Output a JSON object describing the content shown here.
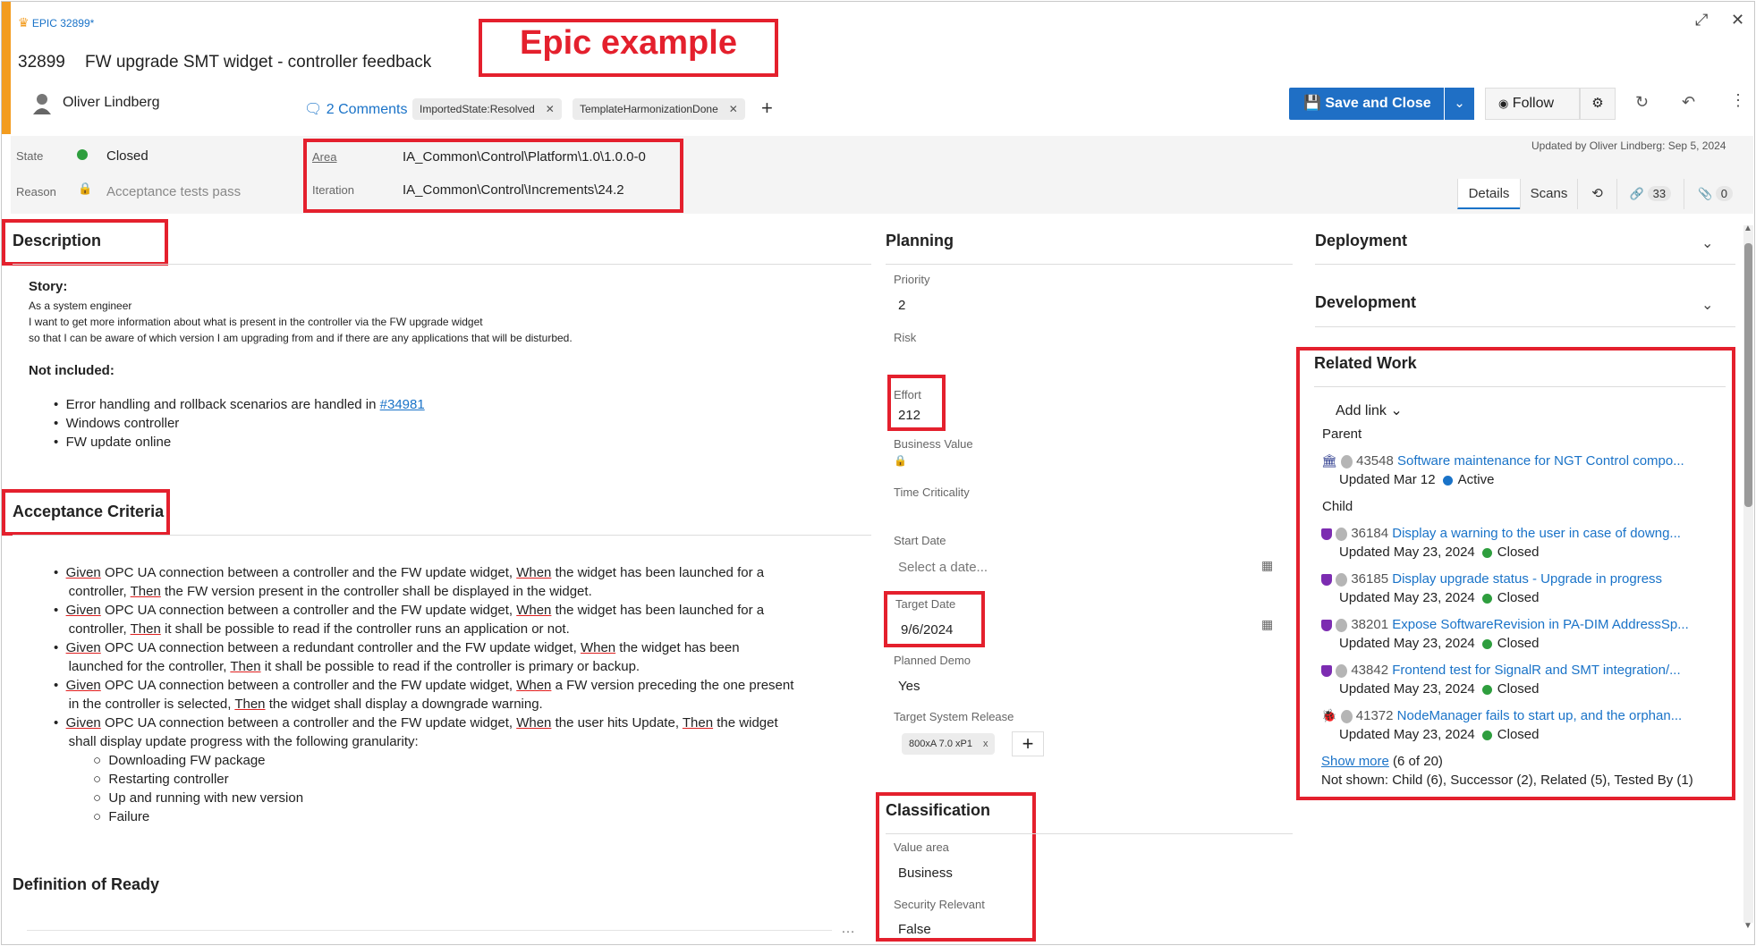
{
  "header": {
    "type_label": "EPIC 32899*",
    "id": "32899",
    "title": "FW upgrade SMT widget - controller feedback",
    "banner": "Epic example",
    "assignee": "Oliver Lindberg",
    "comments": "2 Comments",
    "tags": [
      "ImportedState:Resolved",
      "TemplateHarmonizationDone"
    ],
    "save_close": "Save and Close",
    "follow": "Follow",
    "updated": "Updated by Oliver Lindberg: Sep 5, 2024"
  },
  "status": {
    "state_label": "State",
    "state_value": "Closed",
    "reason_label": "Reason",
    "reason_value": "Acceptance tests pass",
    "area_label": "Area",
    "area_value": "IA_Common\\Control\\Platform\\1.0\\1.0.0-0",
    "iteration_label": "Iteration",
    "iteration_value": "IA_Common\\Control\\Increments\\24.2"
  },
  "tabs": {
    "details": "Details",
    "scans": "Scans",
    "links_count": "33",
    "attach_count": "0"
  },
  "description": {
    "title": "Description",
    "story_label": "Story:",
    "story_lines": [
      "As a system engineer",
      "I want to get more information about what is present in the controller via the FW upgrade widget",
      "so that I can be aware of which version I am upgrading from and if there are any applications that will be disturbed."
    ],
    "not_included_label": "Not included:",
    "ni_item1_text": "Error handling and rollback scenarios are handled in ",
    "ni_item1_link": "#34981",
    "ni_item2": "Windows controller",
    "ni_item3": "FW update online"
  },
  "acceptance": {
    "title": "Acceptance Criteria",
    "kw_given": "Given",
    "kw_when": "When",
    "kw_then": "Then",
    "c1_a": " OPC UA connection between a controller and the FW update widget, ",
    "c1_b": " the widget has been launched for a",
    "c1_c": "controller, ",
    "c1_d": " the FW version present in the controller shall be displayed in the widget.",
    "c2_a": " OPC UA connection between a controller and the FW update widget, ",
    "c2_b": " the widget has been launched for a",
    "c2_c": "controller, ",
    "c2_d": " it shall be possible to read if the controller runs an application or not.",
    "c3_a": " OPC UA connection between a redundant controller and the FW update widget, ",
    "c3_b": " the widget has been",
    "c3_c": "launched for the controller, ",
    "c3_d": " it shall be possible to read if the controller is primary or backup.",
    "c4_a": " OPC UA connection between a controller and the FW update widget, ",
    "c4_b": " a FW version preceding the one present",
    "c4_c": "in the controller is selected, ",
    "c4_d": " the widget shall display a downgrade warning.",
    "c5_a": " OPC UA connection between a controller and the FW update widget, ",
    "c5_b": " the user hits Update, ",
    "c5_c": " the widget",
    "c5_d": "shall display update progress with the following granularity:",
    "sub": [
      "Downloading FW package",
      "Restarting controller",
      "Up and running with new version",
      "Failure"
    ]
  },
  "dor": {
    "title": "Definition of Ready"
  },
  "planning": {
    "title": "Planning",
    "priority_label": "Priority",
    "priority_value": "2",
    "risk_label": "Risk",
    "effort_label": "Effort",
    "effort_value": "212",
    "bv_label": "Business Value",
    "tc_label": "Time Criticality",
    "start_label": "Start Date",
    "start_placeholder": "Select a date...",
    "target_label": "Target Date",
    "target_value": "9/6/2024",
    "demo_label": "Planned Demo",
    "demo_value": "Yes",
    "tsr_label": "Target System Release",
    "tsr_tag": "800xA 7.0 xP1"
  },
  "classification": {
    "title": "Classification",
    "va_label": "Value area",
    "va_value": "Business",
    "sec_label": "Security Relevant",
    "sec_value": "False"
  },
  "deployment": {
    "title": "Deployment"
  },
  "development": {
    "title": "Development"
  },
  "related": {
    "title": "Related Work",
    "add_link": "Add link",
    "parent_label": "Parent",
    "child_label": "Child",
    "parent": {
      "id": "43548",
      "title": "Software maintenance for NGT Control compo...",
      "updated": "Updated Mar 12",
      "state": "Active"
    },
    "children": [
      {
        "id": "36184",
        "title": "Display a warning to the user in case of downg...",
        "updated": "Updated May 23, 2024",
        "state": "Closed"
      },
      {
        "id": "36185",
        "title": "Display upgrade status - Upgrade in progress",
        "updated": "Updated May 23, 2024",
        "state": "Closed"
      },
      {
        "id": "38201",
        "title": "Expose SoftwareRevision in PA-DIM AddressSp...",
        "updated": "Updated May 23, 2024",
        "state": "Closed"
      },
      {
        "id": "43842",
        "title": "Frontend test for SignalR and SMT integration/...",
        "updated": "Updated May 23, 2024",
        "state": "Closed"
      },
      {
        "id": "41372",
        "title": "NodeManager fails to start up, and the orphan...",
        "updated": "Updated May 23, 2024",
        "state": "Closed"
      }
    ],
    "show_more": "Show more",
    "count": "(6 of 20)",
    "not_shown": "Not shown: Child (6), Successor (2), Related (5), Tested By (1)"
  },
  "colors": {
    "accent": "#f39c1f",
    "primary": "#1a73c8",
    "active": "#1a73c8",
    "closed": "#2e9e3e",
    "annot": "#e4202d"
  }
}
